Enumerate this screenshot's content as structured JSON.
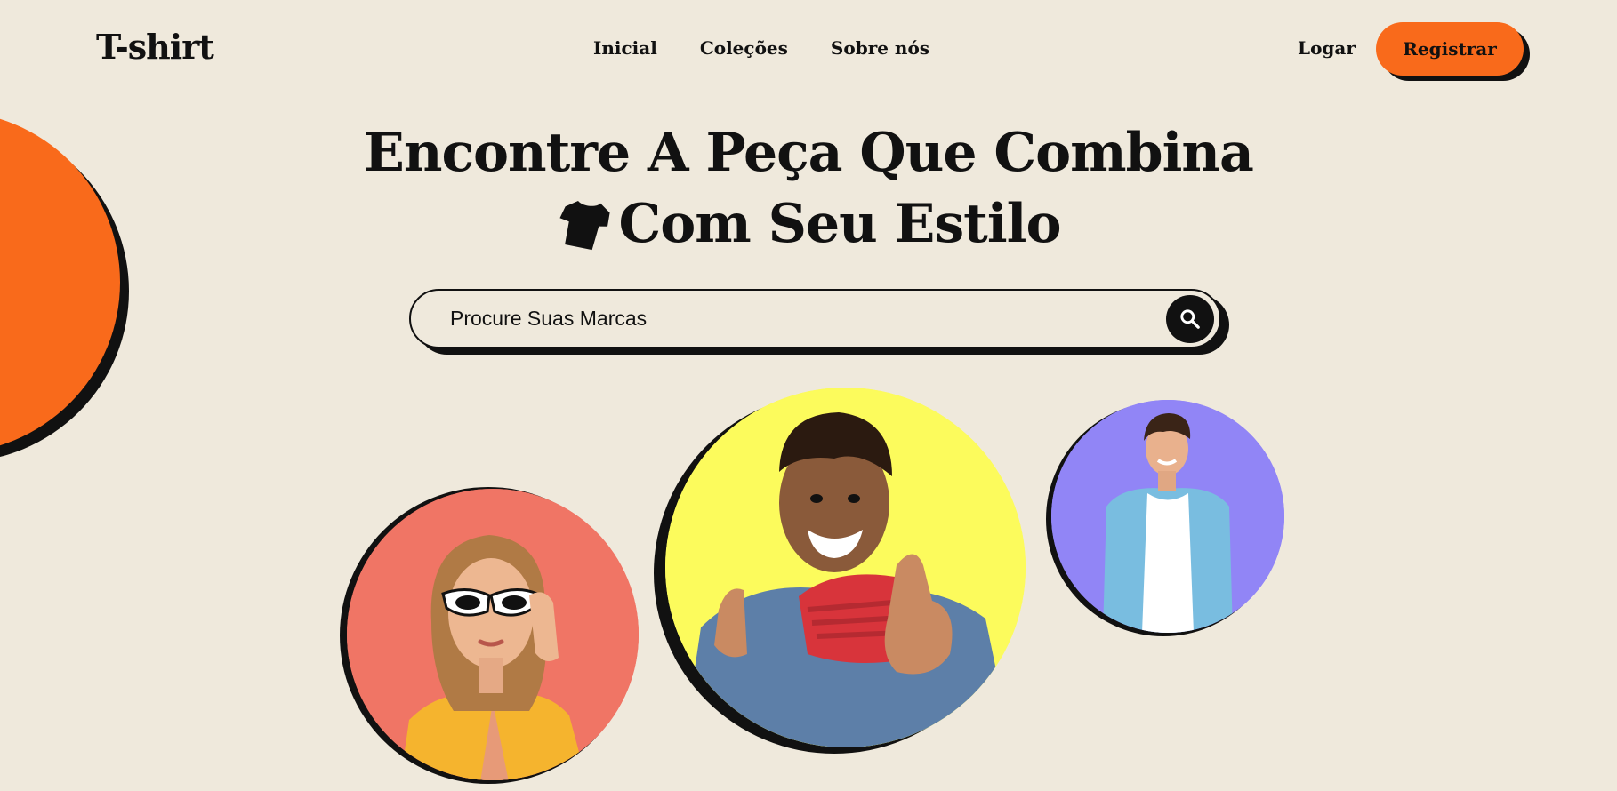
{
  "header": {
    "logo": "T-shirt",
    "nav": [
      "Inicial",
      "Coleções",
      "Sobre nós"
    ],
    "login": "Logar",
    "register": "Registrar"
  },
  "hero": {
    "title_line1": "Encontre A Peça Que Combina",
    "title_line2": "Com Seu Estilo",
    "title_icon": "tshirt-icon"
  },
  "search": {
    "placeholder": "Procure Suas Marcas",
    "icon": "search-icon"
  },
  "colors": {
    "background": "#efe9dc",
    "accent": "#f96a1b",
    "photo_left_bg": "#f07565",
    "photo_center_bg": "#fcfb5c",
    "photo_right_bg": "#9185f6"
  }
}
